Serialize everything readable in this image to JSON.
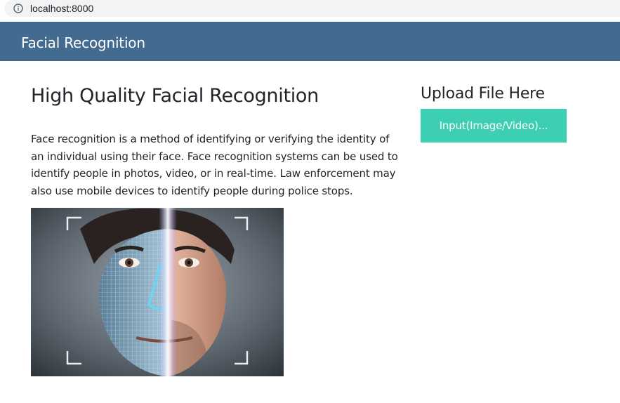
{
  "browser": {
    "url": "localhost:8000",
    "info_icon": "info-icon"
  },
  "navbar": {
    "brand": "Facial Recognition",
    "background": "#436a8f"
  },
  "main": {
    "title": "High Quality Facial Recognition",
    "description": "Face recognition is a method of identifying or verifying the identity of an individual using their face. Face recognition systems can be used to identify people in photos, video, or in real-time. Law enforcement may also use mobile devices to identify people during police stops.",
    "image_alt": "face scan"
  },
  "upload": {
    "title": "Upload File Here",
    "button_label": "Input(Image/Video)...",
    "button_color": "#3ccfb1"
  }
}
